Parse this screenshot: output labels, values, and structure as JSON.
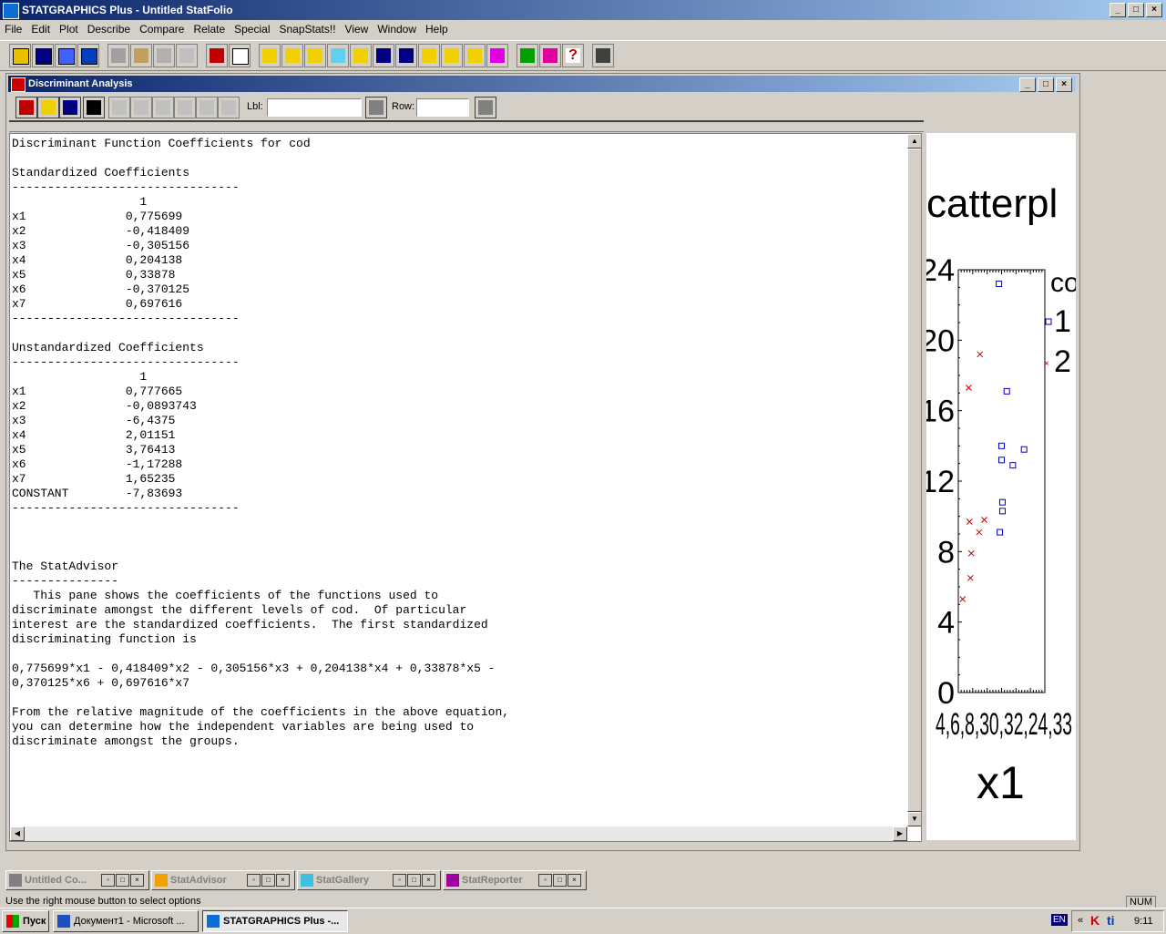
{
  "app": {
    "title": "STATGRAPHICS Plus - Untitled StatFolio"
  },
  "menu": [
    "File",
    "Edit",
    "Plot",
    "Describe",
    "Compare",
    "Relate",
    "Special",
    "SnapStats!!",
    "View",
    "Window",
    "Help"
  ],
  "child": {
    "title": "Discriminant Analysis",
    "lbl_label": "Lbl:",
    "row_label": "Row:",
    "lbl_value": "",
    "row_value": ""
  },
  "output": {
    "lines": [
      "Discriminant Function Coefficients for cod",
      "",
      "Standardized Coefficients",
      "--------------------------------",
      "                  1",
      "x1              0,775699",
      "x2              -0,418409",
      "x3              -0,305156",
      "x4              0,204138",
      "x5              0,33878",
      "x6              -0,370125",
      "x7              0,697616",
      "--------------------------------",
      "",
      "Unstandardized Coefficients",
      "--------------------------------",
      "                  1",
      "x1              0,777665",
      "x2              -0,0893743",
      "x3              -6,4375",
      "x4              2,01151",
      "x5              3,76413",
      "x6              -1,17288",
      "x7              1,65235",
      "CONSTANT        -7,83693",
      "--------------------------------",
      "",
      "",
      "",
      "The StatAdvisor",
      "---------------",
      "   This pane shows the coefficients of the functions used to",
      "discriminate amongst the different levels of cod.  Of particular",
      "interest are the standardized coefficients.  The first standardized",
      "discriminating function is",
      "",
      "0,775699*x1 - 0,418409*x2 - 0,305156*x3 + 0,204138*x4 + 0,33878*x5 -",
      "0,370125*x6 + 0,697616*x7",
      "",
      "From the relative magnitude of the coefficients in the above equation,",
      "you can determine how the independent variables are being used to",
      "discriminate amongst the groups."
    ]
  },
  "chart_data": {
    "type": "scatter",
    "title": "catterpl",
    "xlabel": "x1",
    "ylabel": "",
    "ylim": [
      0,
      24
    ],
    "y_ticks": [
      "0",
      "4",
      "8",
      "12",
      "16",
      "20",
      "24"
    ],
    "x_tick_text": "4,6,8,30,32,24,33",
    "legend_title": "co",
    "legend": [
      {
        "name": "1",
        "marker": "square",
        "color": "#0000c0"
      },
      {
        "name": "2",
        "marker": "x",
        "color": "#c00000"
      }
    ],
    "series": [
      {
        "name": "1",
        "color": "#0000c0",
        "points": [
          [
            0.47,
            23.2
          ],
          [
            0.56,
            17.1
          ],
          [
            0.5,
            14.0
          ],
          [
            0.76,
            13.8
          ],
          [
            0.63,
            12.9
          ],
          [
            0.5,
            13.2
          ],
          [
            0.51,
            10.8
          ],
          [
            0.51,
            10.3
          ],
          [
            0.48,
            9.1
          ]
        ]
      },
      {
        "name": "2",
        "color": "#c00000",
        "points": [
          [
            0.25,
            19.2
          ],
          [
            0.12,
            17.3
          ],
          [
            0.13,
            9.7
          ],
          [
            0.3,
            9.8
          ],
          [
            0.24,
            9.1
          ],
          [
            0.15,
            7.9
          ],
          [
            0.14,
            6.5
          ],
          [
            0.05,
            5.3
          ]
        ]
      }
    ]
  },
  "mdi": [
    {
      "label": "Untitled Co...",
      "color": "#808080"
    },
    {
      "label": "StatAdvisor",
      "color": "#000"
    },
    {
      "label": "StatGallery",
      "color": "#008000"
    },
    {
      "label": "StatReporter",
      "color": "#800000"
    }
  ],
  "status": {
    "text": "Use the right mouse button to select options",
    "num": "NUM"
  },
  "taskbar": {
    "start": "Пуск",
    "tasks": [
      "Документ1 - Microsoft ...",
      "STATGRAPHICS Plus -..."
    ],
    "lang": "EN",
    "clock": "9:11"
  }
}
